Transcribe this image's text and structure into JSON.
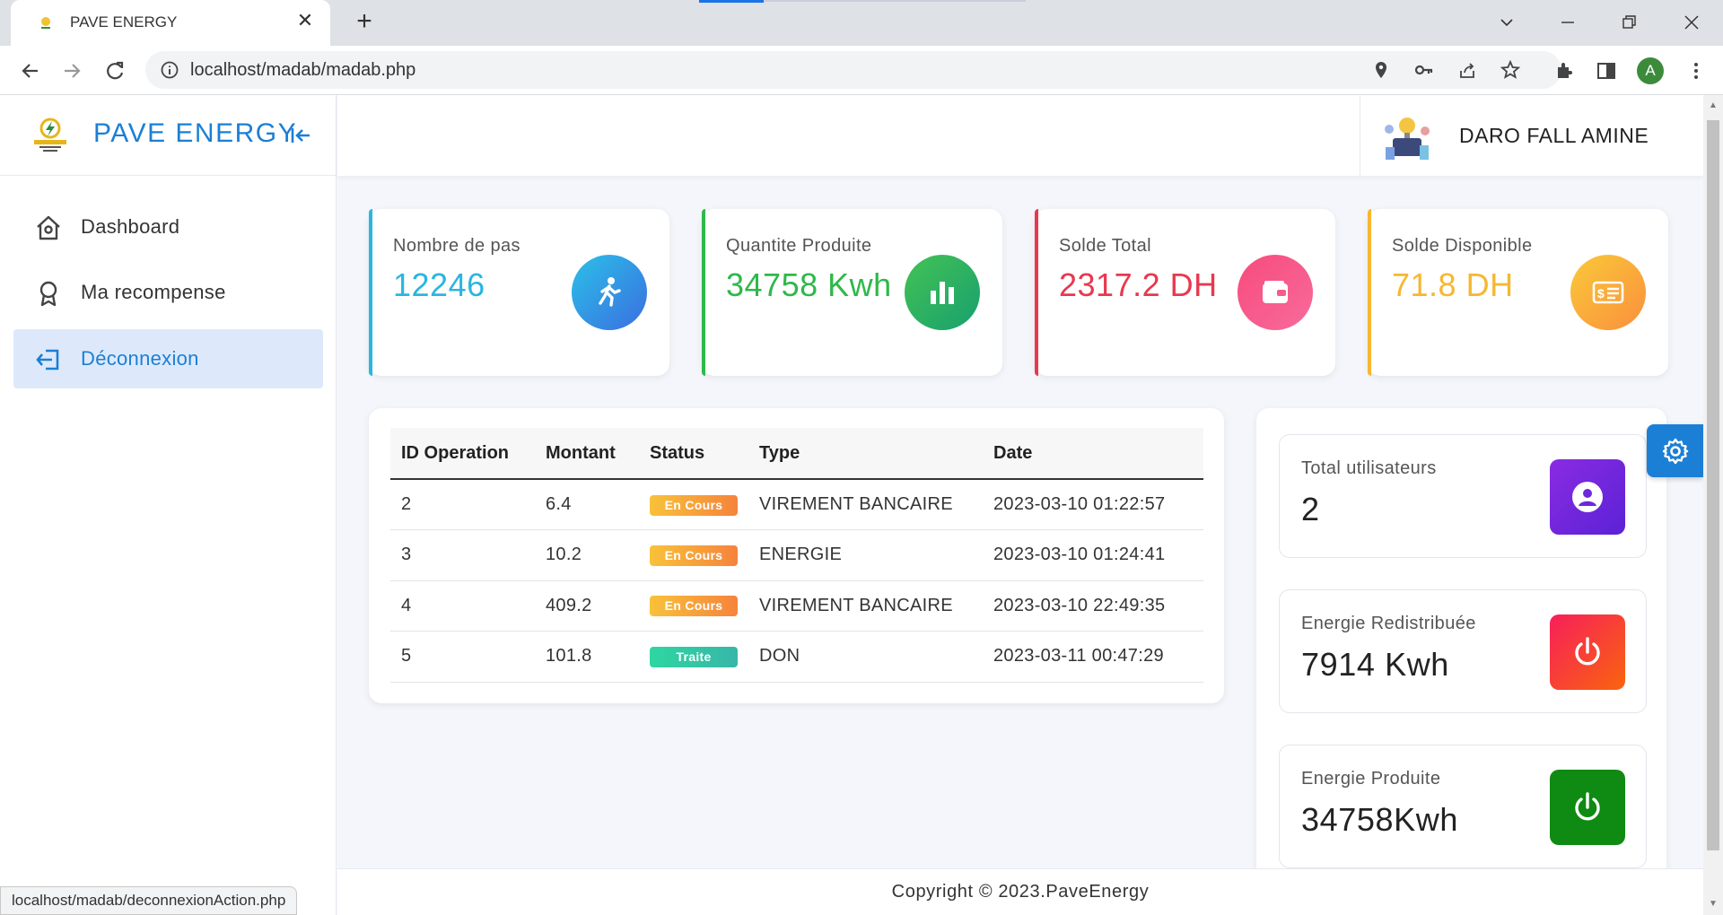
{
  "browser": {
    "tab_title": "PAVE ENERGY",
    "url": "localhost/madab/madab.php",
    "profile_initial": "A",
    "status_url": "localhost/madab/deconnexionAction.php"
  },
  "brand": {
    "name": "PAVE ENERGY"
  },
  "sidebar": {
    "items": [
      {
        "label": "Dashboard",
        "icon": "home-icon",
        "active": false
      },
      {
        "label": "Ma recompense",
        "icon": "award-icon",
        "active": false
      },
      {
        "label": "Déconnexion",
        "icon": "logout-icon",
        "active": true
      }
    ]
  },
  "user": {
    "name": "DARO FALL AMINE"
  },
  "stats": [
    {
      "label": "Nombre de pas",
      "value": "12246",
      "color": "#29b6e0",
      "icon": "walking-icon"
    },
    {
      "label": "Quantite Produite",
      "value": "34758 Kwh",
      "color": "#2fb84a",
      "icon": "bar-chart-icon"
    },
    {
      "label": "Solde Total",
      "value": "2317.2 DH",
      "color": "#e8384f",
      "icon": "wallet-icon"
    },
    {
      "label": "Solde Disponible",
      "value": "71.8 DH",
      "color": "#f6b731",
      "icon": "money-card-icon"
    }
  ],
  "operations": {
    "headers": [
      "ID Operation",
      "Montant",
      "Status",
      "Type",
      "Date"
    ],
    "rows": [
      {
        "id": "2",
        "montant": "6.4",
        "status": "En Cours",
        "type": "VIREMENT BANCAIRE",
        "date": "2023-03-10 01:22:57"
      },
      {
        "id": "3",
        "montant": "10.2",
        "status": "En Cours",
        "type": "ENERGIE",
        "date": "2023-03-10 01:24:41"
      },
      {
        "id": "4",
        "montant": "409.2",
        "status": "En Cours",
        "type": "VIREMENT BANCAIRE",
        "date": "2023-03-10 22:49:35"
      },
      {
        "id": "5",
        "montant": "101.8",
        "status": "Traite",
        "type": "DON",
        "date": "2023-03-11 00:47:29"
      }
    ]
  },
  "summary": [
    {
      "label": "Total utilisateurs",
      "value": "2",
      "icon": "user-icon"
    },
    {
      "label": "Energie Redistribuée",
      "value": "7914 Kwh",
      "icon": "power-icon"
    },
    {
      "label": "Energie Produite",
      "value": "34758Kwh",
      "icon": "power-icon"
    }
  ],
  "footer": {
    "copyright": "Copyright © 2023.PaveEnergy"
  }
}
